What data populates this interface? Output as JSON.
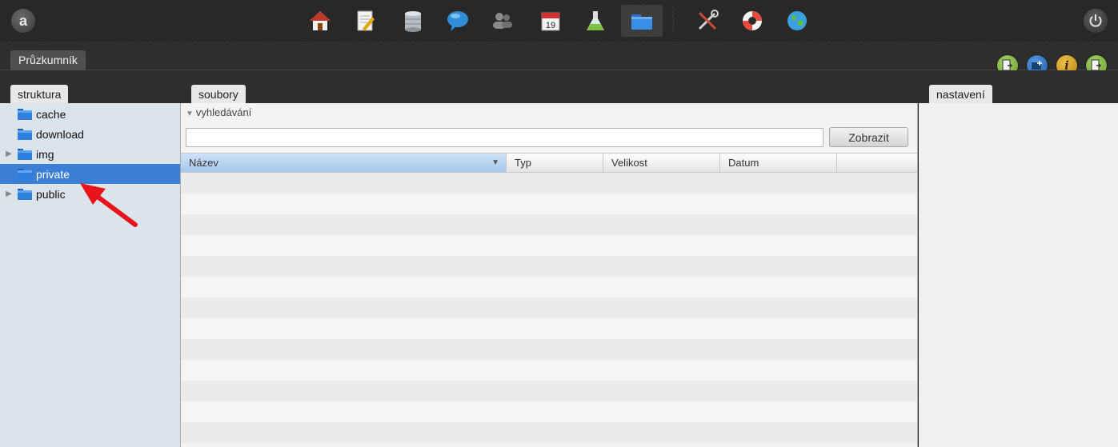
{
  "app": {
    "logo_letter": "a",
    "main_tab": "Průzkumník"
  },
  "toolbar": {
    "icons": [
      {
        "name": "home-icon",
        "color": "#c0392b"
      },
      {
        "name": "edit-page-icon",
        "color": "#e0a800"
      },
      {
        "name": "database-icon",
        "color": "#9aa0a6"
      },
      {
        "name": "chat-bubble-icon",
        "color": "#2f8ed8"
      },
      {
        "name": "users-icon",
        "color": "#8a8a8a"
      },
      {
        "name": "calendar-icon",
        "color": "#d0312d"
      },
      {
        "name": "flask-icon",
        "color": "#7bc043"
      },
      {
        "name": "folder-icon",
        "color": "#3a8ee6"
      },
      {
        "name": "tools-icon",
        "color": "#cfcfcf"
      },
      {
        "name": "lifebuoy-icon",
        "color": "#e74c3c"
      },
      {
        "name": "globe-icon",
        "color": "#3aa0e0"
      }
    ],
    "calendar_day": "19"
  },
  "action_buttons": [
    {
      "name": "new-file-button",
      "color": "#7ab33a"
    },
    {
      "name": "new-folder-button",
      "color": "#2a6fc0"
    },
    {
      "name": "info-button",
      "color": "#d7a21a"
    },
    {
      "name": "upload-button",
      "color": "#7ab33a"
    }
  ],
  "panels": {
    "left_tab": "struktura",
    "center_tab": "soubory",
    "right_tab": "nastavení"
  },
  "tree": {
    "items": [
      {
        "label": "cache",
        "expandable": false,
        "selected": false
      },
      {
        "label": "download",
        "expandable": false,
        "selected": false
      },
      {
        "label": "img",
        "expandable": true,
        "selected": false
      },
      {
        "label": "private",
        "expandable": false,
        "selected": true
      },
      {
        "label": "public",
        "expandable": true,
        "selected": false
      }
    ]
  },
  "files": {
    "search_toggle": "vyhledávání",
    "search_value": "",
    "show_button": "Zobrazit",
    "columns": [
      "Název",
      "Typ",
      "Velikost",
      "Datum"
    ],
    "sorted_column": "Název",
    "empty_rows": 13
  },
  "colors": {
    "selected_row": "#3a7fd3",
    "annotation_arrow": "#e8141b"
  }
}
